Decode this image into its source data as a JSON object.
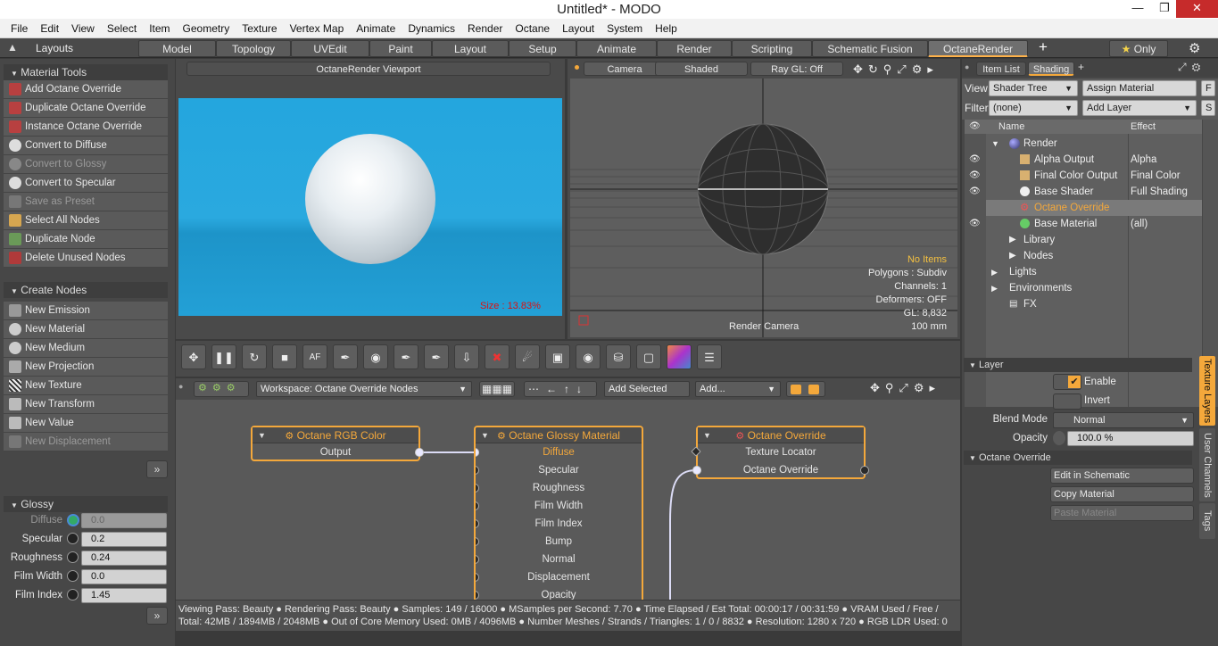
{
  "title": "Untitled* - MODO",
  "menu": [
    "File",
    "Edit",
    "View",
    "Select",
    "Item",
    "Geometry",
    "Texture",
    "Vertex Map",
    "Animate",
    "Dynamics",
    "Render",
    "Octane",
    "Layout",
    "System",
    "Help"
  ],
  "layouts_label": "Layouts",
  "tabs": [
    "Model",
    "Topology",
    "UVEdit",
    "Paint",
    "Layout",
    "Setup",
    "Animate",
    "Render",
    "Scripting",
    "Schematic Fusion",
    "OctaneRender"
  ],
  "only_label": "Only",
  "material_tools": {
    "header": "Material Tools",
    "items": [
      "Add Octane Override",
      "Duplicate Octane Override",
      "Instance Octane Override",
      "Convert to Diffuse",
      "Convert to Glossy",
      "Convert to Specular",
      "Save as Preset",
      "Select All Nodes",
      "Duplicate Node",
      "Delete Unused Nodes"
    ]
  },
  "create_nodes": {
    "header": "Create Nodes",
    "items": [
      "New Emission",
      "New Material",
      "New Medium",
      "New Projection",
      "New Texture",
      "New Transform",
      "New Value",
      "New Displacement"
    ]
  },
  "glossy": {
    "header": "Glossy",
    "props": [
      {
        "label": "Diffuse",
        "value": "0.0"
      },
      {
        "label": "Specular",
        "value": "0.2"
      },
      {
        "label": "Roughness",
        "value": "0.24"
      },
      {
        "label": "Film Width",
        "value": "0.0"
      },
      {
        "label": "Film Index",
        "value": "1.45"
      }
    ]
  },
  "octane_viewport": {
    "title": "OctaneRender Viewport",
    "size_text": "Size : 13.83%"
  },
  "view3d": {
    "camera": "Camera",
    "shaded": "Shaded",
    "raygl": "Ray GL: Off",
    "info": [
      "No Items",
      "Polygons : Subdiv",
      "Channels: 1",
      "Deformers: OFF",
      "GL: 8,832",
      "100 mm"
    ],
    "render_camera": "Render Camera"
  },
  "node_toolbar": {
    "workspace": "Workspace: Octane Override Nodes",
    "add_selected": "Add Selected",
    "add": "Add..."
  },
  "nodes": {
    "rgb": {
      "title": "Octane RGB Color",
      "ports": [
        "Output"
      ]
    },
    "glossy": {
      "title": "Octane Glossy Material",
      "ports": [
        "Diffuse",
        "Specular",
        "Roughness",
        "Film Width",
        "Film Index",
        "Bump",
        "Normal",
        "Displacement",
        "Opacity"
      ]
    },
    "override": {
      "title": "Octane Override",
      "ports": [
        "Texture Locator",
        "Octane Override"
      ]
    }
  },
  "status": {
    "line1": "Viewing Pass: Beauty ● Rendering Pass: Beauty ● Samples: 149 / 16000 ● MSamples per Second: 7.70 ● Time Elapsed / Est Total: 00:00:17 / 00:31:59 ● VRAM Used / Free /",
    "line2": "Total: 42MB / 1894MB / 2048MB ● Out of Core Memory Used: 0MB / 4096MB ● Number Meshes / Strands / Triangles: 1 / 0 / 8832 ● Resolution: 1280 x 720 ● RGB LDR Used: 0"
  },
  "right": {
    "tab_itemlist": "Item List",
    "tab_shading": "Shading",
    "view_label": "View",
    "view_value": "Shader Tree",
    "assign": "Assign Material",
    "filter_label": "Filter",
    "filter_value": "(none)",
    "add_layer": "Add Layer",
    "col_name": "Name",
    "col_effect": "Effect",
    "tree": [
      {
        "name": "Render",
        "effect": ""
      },
      {
        "name": "Alpha Output",
        "effect": "Alpha"
      },
      {
        "name": "Final Color Output",
        "effect": "Final Color"
      },
      {
        "name": "Base Shader",
        "effect": "Full Shading"
      },
      {
        "name": "Octane Override",
        "effect": ""
      },
      {
        "name": "Base Material",
        "effect": "(all)"
      },
      {
        "name": "Library",
        "effect": ""
      },
      {
        "name": "Nodes",
        "effect": ""
      },
      {
        "name": "Lights",
        "effect": ""
      },
      {
        "name": "Environments",
        "effect": ""
      },
      {
        "name": "FX",
        "effect": ""
      }
    ],
    "layer_header": "Layer",
    "enable": "Enable",
    "invert": "Invert",
    "blend_label": "Blend Mode",
    "blend_value": "Normal",
    "opacity_label": "Opacity",
    "opacity_value": "100.0 %",
    "oo_header": "Octane Override",
    "edit_schematic": "Edit in Schematic",
    "copy_material": "Copy Material",
    "paste_material": "Paste Material",
    "side_tabs": [
      "Texture Layers",
      "User Channels",
      "Tags"
    ]
  },
  "colors": {
    "accent": "#f4a83b",
    "viewport_bg": "#23a5dc"
  }
}
